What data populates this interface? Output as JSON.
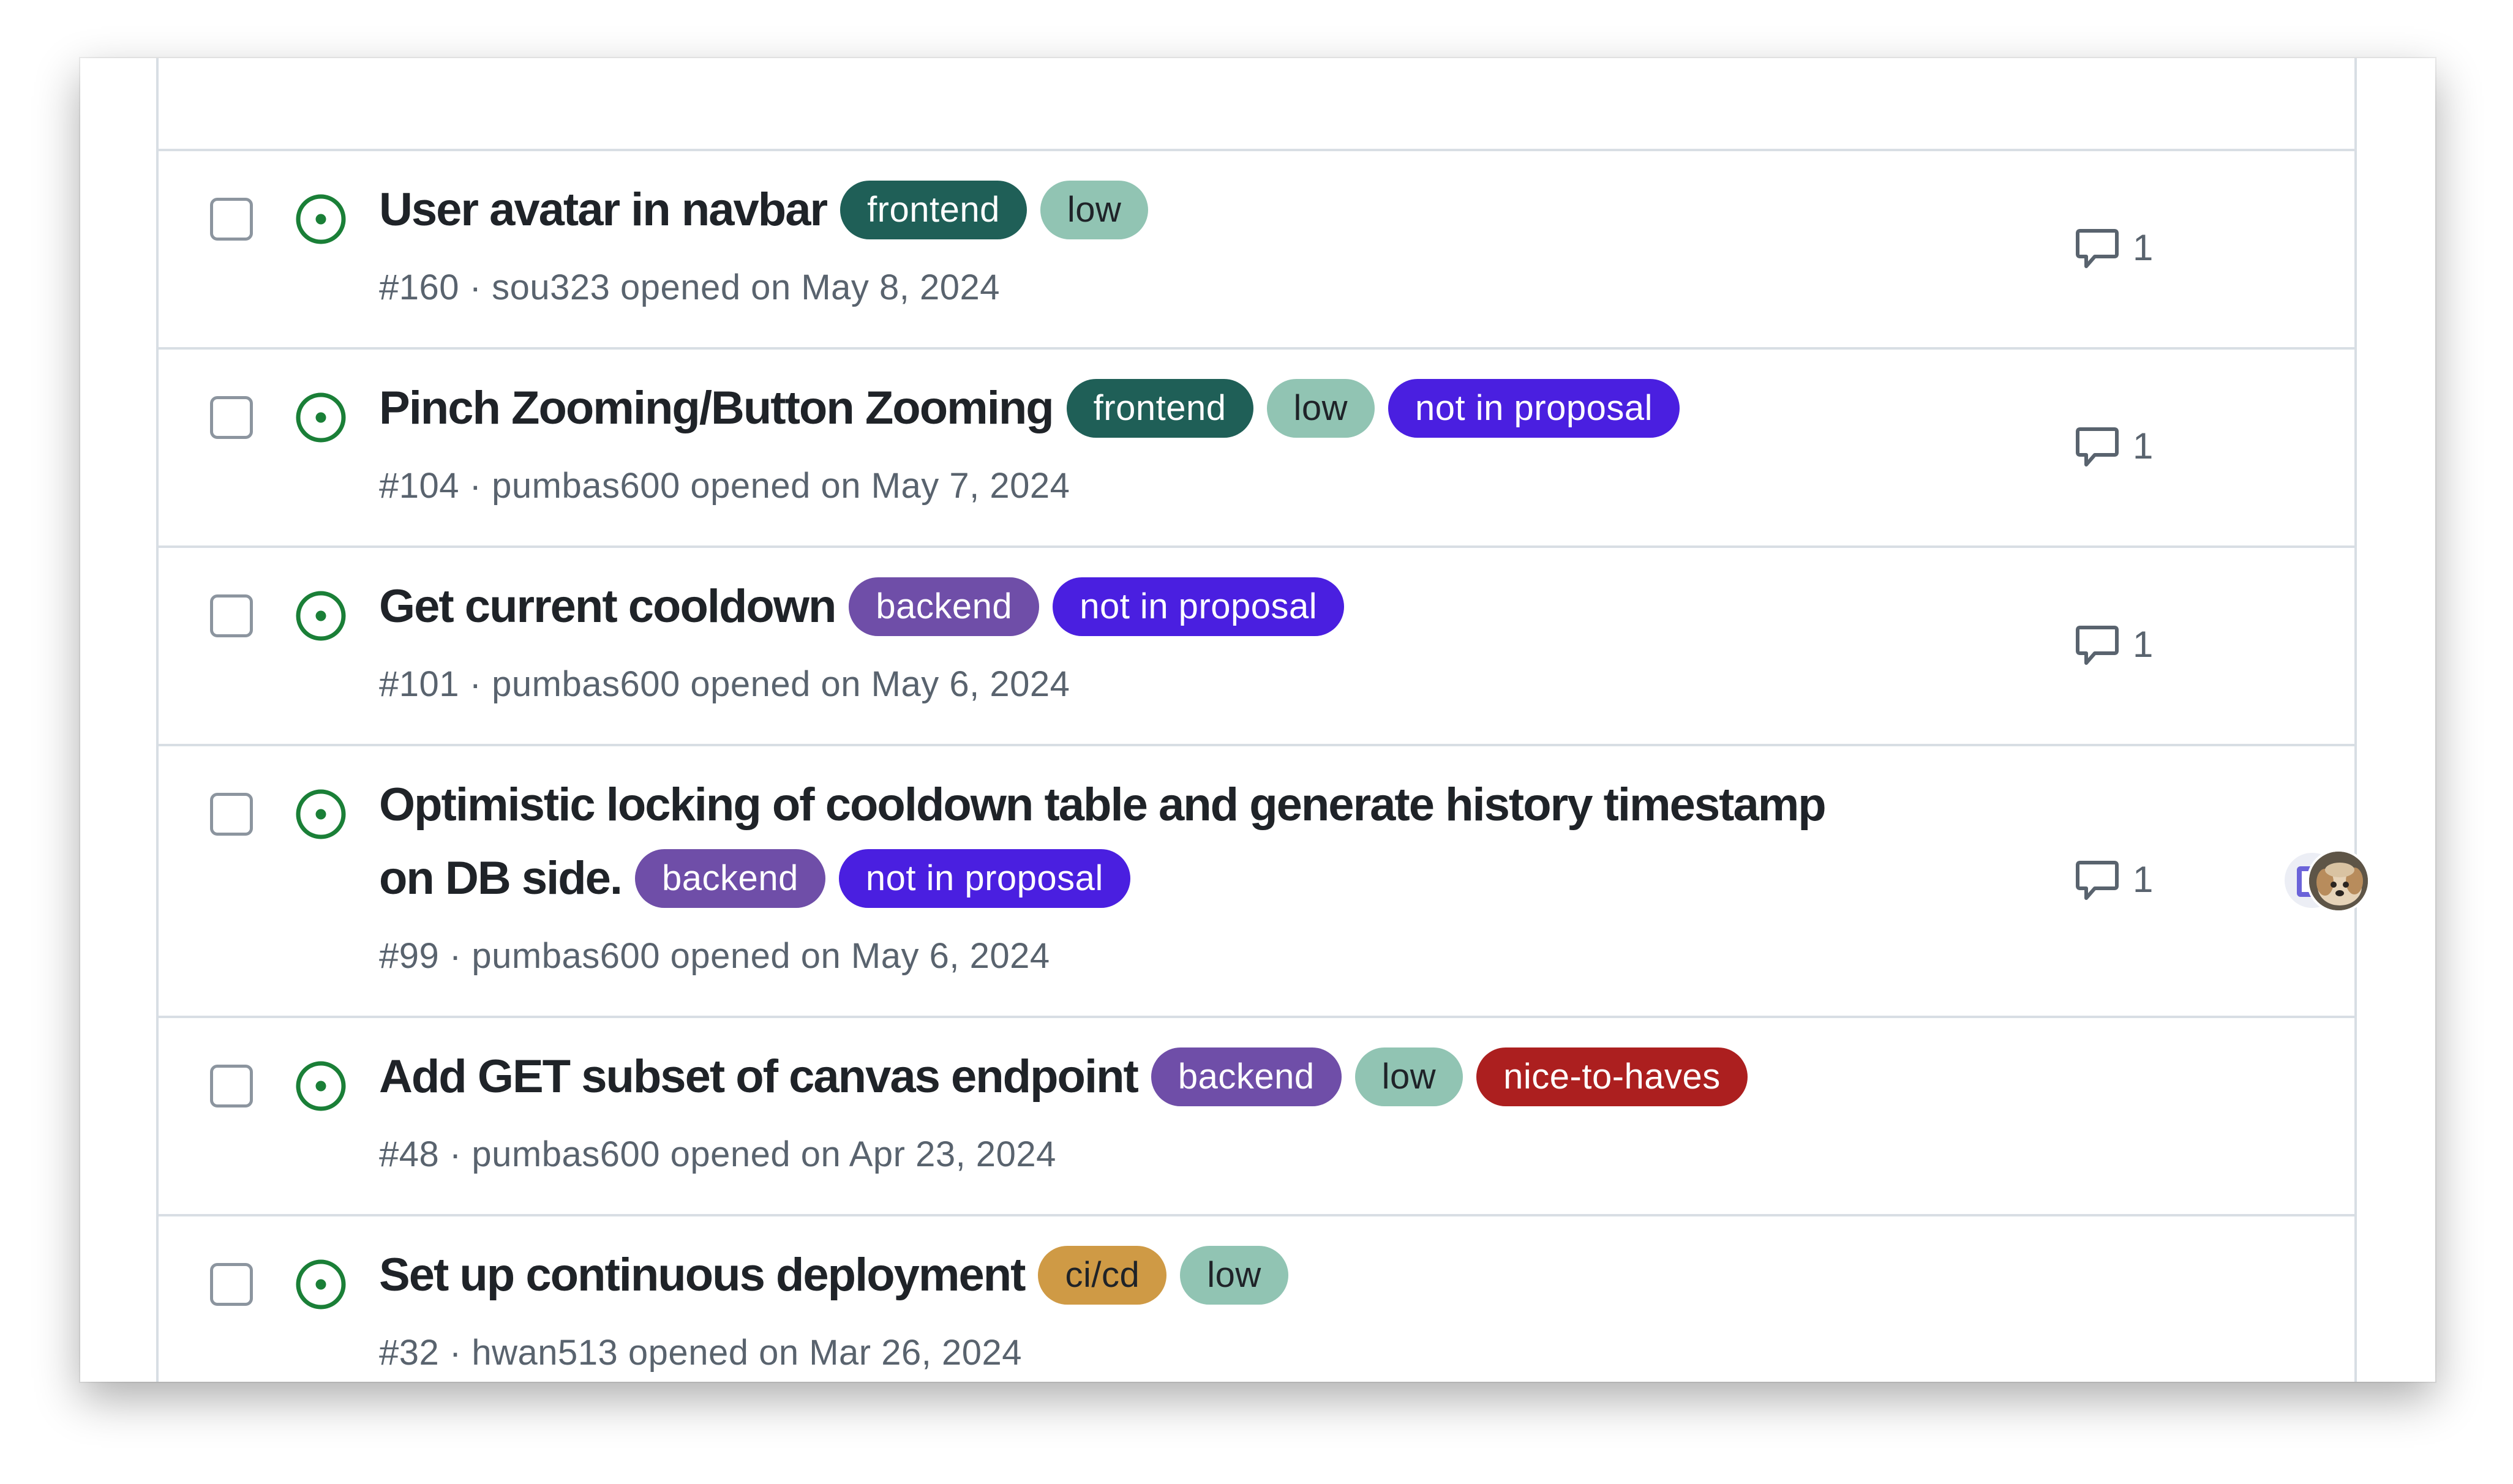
{
  "colors": {
    "open_icon": "#1a7f37",
    "label_frontend_bg": "#1f5f57",
    "label_frontend_fg": "#ffffff",
    "label_low_bg": "#91c4b3",
    "label_low_fg": "#1f2328",
    "label_not_in_proposal_bg": "#4a1fe0",
    "label_not_in_proposal_fg": "#ffffff",
    "label_backend_bg": "#6f4ea8",
    "label_backend_fg": "#ffffff",
    "label_nice_to_haves_bg": "#ac1f1f",
    "label_nice_to_haves_fg": "#ffffff",
    "label_cicd_bg": "#cf9a45",
    "label_cicd_fg": "#1f2328"
  },
  "icons": {
    "status": "issue-opened-icon",
    "comments": "comment-icon"
  },
  "issues": [
    {
      "title": "User avatar in navbar",
      "labels": [
        "frontend",
        "low"
      ],
      "number": "#160",
      "separator": "·",
      "author": "sou323",
      "opened_text": "opened on May 8, 2024",
      "comments": "1"
    },
    {
      "title": "Pinch Zooming/Button Zooming",
      "labels": [
        "frontend",
        "low",
        "not in proposal"
      ],
      "number": "#104",
      "separator": "·",
      "author": "pumbas600",
      "opened_text": "opened on May 7, 2024",
      "comments": "1"
    },
    {
      "title": "Get current cooldown",
      "labels": [
        "backend",
        "not in proposal"
      ],
      "number": "#101",
      "separator": "·",
      "author": "pumbas600",
      "opened_text": "opened on May 6, 2024",
      "comments": "1"
    },
    {
      "title": "Optimistic locking of cooldown table and generate history timestamp on DB side.",
      "labels": [
        "backend",
        "not in proposal"
      ],
      "number": "#99",
      "separator": "·",
      "author": "pumbas600",
      "opened_text": "opened on May 6, 2024",
      "comments": "1",
      "assignees": [
        "assignee-avatar",
        "assignee-avatar-dog"
      ]
    },
    {
      "title": "Add GET subset of canvas endpoint",
      "labels": [
        "backend",
        "low",
        "nice-to-haves"
      ],
      "number": "#48",
      "separator": "·",
      "author": "pumbas600",
      "opened_text": "opened on Apr 23, 2024"
    },
    {
      "title": "Set up continuous deployment",
      "labels": [
        "ci/cd",
        "low"
      ],
      "number": "#32",
      "separator": "·",
      "author": "hwan513",
      "opened_text": "opened on Mar 26, 2024"
    }
  ]
}
